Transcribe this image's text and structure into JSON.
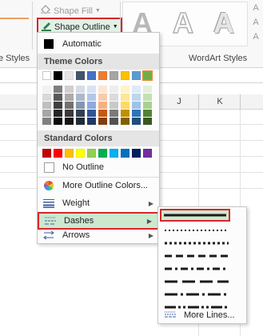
{
  "ribbon": {
    "shape_fill_label": "Shape Fill",
    "shape_outline_label": "Shape Outline",
    "shape_styles_label": "e Styles",
    "wordart_styles_label": "WordArt Styles",
    "wordart_letter": "A",
    "side_small_icons": [
      "A",
      "A",
      "A"
    ]
  },
  "columns": {
    "j": "J",
    "k": "K"
  },
  "menu": {
    "automatic_label": "Automatic",
    "theme_colors_header": "Theme Colors",
    "standard_colors_header": "Standard Colors",
    "no_outline_label": "No Outline",
    "more_colors_label": "More Outline Colors...",
    "weight_label": "Weight",
    "dashes_label": "Dashes",
    "arrows_label": "Arrows",
    "theme_colors": [
      "#ffffff",
      "#000000",
      "#e7e6e6",
      "#44546a",
      "#4472c4",
      "#ed7d31",
      "#a5a5a5",
      "#ffc000",
      "#5b9bd5",
      "#70ad47"
    ],
    "theme_shades": [
      [
        "#f2f2f2",
        "#d9d9d9",
        "#bfbfbf",
        "#a6a6a6",
        "#808080"
      ],
      [
        "#7f7f7f",
        "#595959",
        "#404040",
        "#262626",
        "#0d0d0d"
      ],
      [
        "#d0cece",
        "#aeaaaa",
        "#757171",
        "#3a3838",
        "#171616"
      ],
      [
        "#d6dce4",
        "#adb9ca",
        "#8497b0",
        "#333f4f",
        "#222a35"
      ],
      [
        "#d9e2f3",
        "#b4c7e7",
        "#8faadc",
        "#2f5597",
        "#1f3864"
      ],
      [
        "#fbe5d6",
        "#f8cbad",
        "#f4b183",
        "#c55a11",
        "#843c0c"
      ],
      [
        "#ededed",
        "#dbdbdb",
        "#c9c9c9",
        "#7b7b7b",
        "#525252"
      ],
      [
        "#fff2cc",
        "#ffe699",
        "#ffd966",
        "#bf9000",
        "#7f6000"
      ],
      [
        "#deebf7",
        "#bdd7ee",
        "#9dc3e6",
        "#2e75b6",
        "#1f4e79"
      ],
      [
        "#e2f0d9",
        "#c5e0b4",
        "#a9d18e",
        "#548235",
        "#385723"
      ]
    ],
    "standard_colors": [
      "#c00000",
      "#ff0000",
      "#ffc000",
      "#ffff00",
      "#92d050",
      "#00b050",
      "#00b0f0",
      "#0070c0",
      "#002060",
      "#7030a0"
    ],
    "outline_color": "#70ad47"
  },
  "submenu": {
    "more_lines_label": "More Lines...",
    "dash_styles": [
      "solid",
      "round-dot",
      "square-dot",
      "dash",
      "dash-dot",
      "long-dash",
      "long-dash-dot",
      "long-dash-dot-dot"
    ]
  }
}
